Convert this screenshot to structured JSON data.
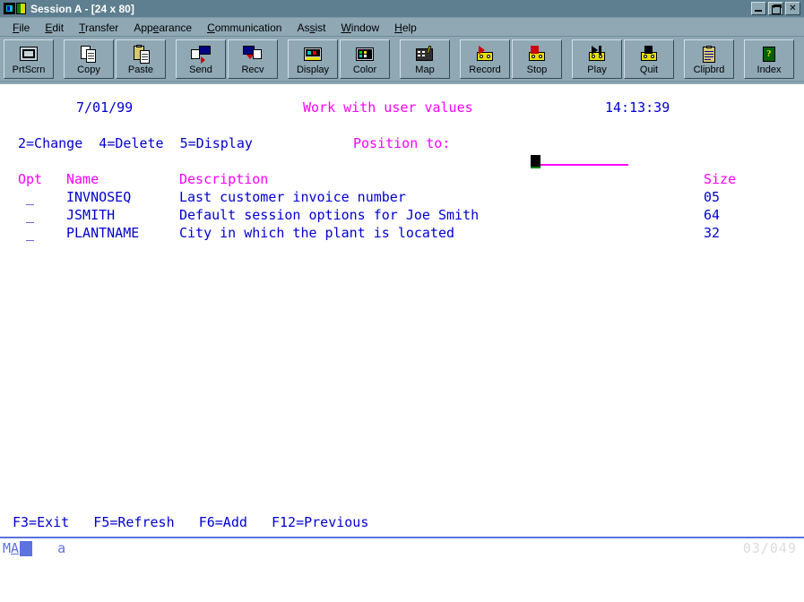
{
  "window": {
    "title": "Session A - [24 x 80]",
    "icons": [
      "monitor-icon",
      "book-icon"
    ],
    "controls": [
      {
        "name": "minimize-button",
        "glyph": "_"
      },
      {
        "name": "restore-button",
        "glyph": "❐"
      },
      {
        "name": "close-button",
        "glyph": "✕"
      }
    ]
  },
  "menubar": {
    "items": [
      {
        "label": "File",
        "accel_index": 0
      },
      {
        "label": "Edit",
        "accel_index": 0
      },
      {
        "label": "Transfer",
        "accel_index": 0
      },
      {
        "label": "Appearance",
        "accel_index": 3
      },
      {
        "label": "Communication",
        "accel_index": 0
      },
      {
        "label": "Assist",
        "accel_index": 2
      },
      {
        "label": "Window",
        "accel_index": 0
      },
      {
        "label": "Help",
        "accel_index": 0
      }
    ]
  },
  "toolbar": {
    "groups": [
      {
        "buttons": [
          {
            "label": "PrtScrn",
            "icon": "print-screen-icon"
          }
        ]
      },
      {
        "buttons": [
          {
            "label": "Copy",
            "icon": "copy-icon"
          },
          {
            "label": "Paste",
            "icon": "paste-icon"
          }
        ]
      },
      {
        "buttons": [
          {
            "label": "Send",
            "icon": "send-file-icon"
          },
          {
            "label": "Recv",
            "icon": "receive-file-icon"
          }
        ]
      },
      {
        "buttons": [
          {
            "label": "Display",
            "icon": "display-settings-icon"
          },
          {
            "label": "Color",
            "icon": "color-settings-icon"
          }
        ]
      },
      {
        "buttons": [
          {
            "label": "Map",
            "icon": "keyboard-map-icon"
          }
        ]
      },
      {
        "buttons": [
          {
            "label": "Record",
            "icon": "record-icon"
          },
          {
            "label": "Stop",
            "icon": "stop-icon"
          }
        ]
      },
      {
        "buttons": [
          {
            "label": "Play",
            "icon": "play-icon"
          },
          {
            "label": "Quit",
            "icon": "quit-icon"
          }
        ]
      },
      {
        "buttons": [
          {
            "label": "Clipbrd",
            "icon": "clipboard-icon"
          }
        ]
      },
      {
        "buttons": [
          {
            "label": "Index",
            "icon": "index-help-icon"
          }
        ]
      }
    ]
  },
  "screen": {
    "date": "7/01/99",
    "title": "Work with user values",
    "time": "14:13:39",
    "options_legend": "2=Change  4=Delete  5=Display",
    "position_label": "Position to:",
    "position_value": "",
    "position_field_width": 9,
    "columns": {
      "opt": "Opt",
      "name": "Name",
      "description": "Description",
      "size": "Size"
    },
    "rows": [
      {
        "opt": "_",
        "name": "INVNOSEQ",
        "description": "Last customer invoice number",
        "size": "05"
      },
      {
        "opt": "_",
        "name": "JSMITH",
        "description": "Default session options for Joe Smith",
        "size": "64"
      },
      {
        "opt": "_",
        "name": "PLANTNAME",
        "description": "City in which the plant is located",
        "size": "32"
      }
    ],
    "function_keys": "F3=Exit   F5=Refresh   F6=Add   F12=Previous",
    "colors": {
      "text_blue": "#0000d0",
      "text_magenta": "#ff00ff",
      "background": "#ffffff"
    }
  },
  "statusbar": {
    "mode": "MA",
    "indicator": "a",
    "position": "03/049",
    "color": "#5b72e0"
  }
}
